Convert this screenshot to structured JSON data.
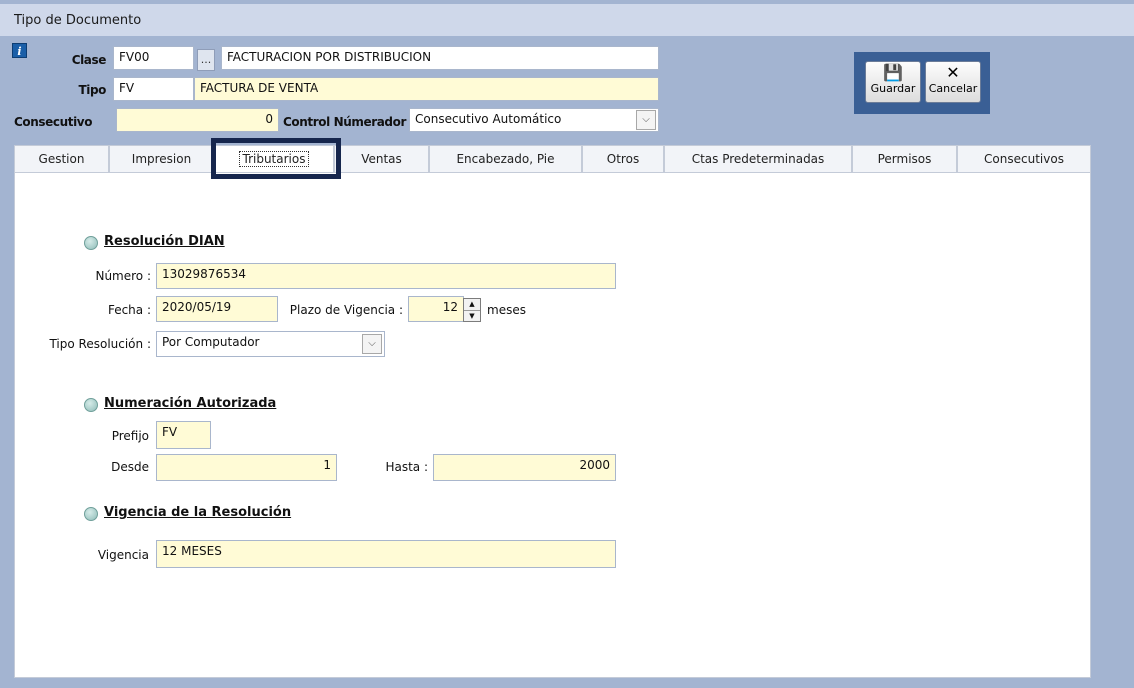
{
  "window": {
    "title": "Tipo de Documento"
  },
  "header": {
    "clase_label": "Clase",
    "clase_code": "FV00",
    "clase_dots": "...",
    "clase_desc": "FACTURACION POR DISTRIBUCION",
    "tipo_label": "Tipo",
    "tipo_code": "FV",
    "tipo_desc": "FACTURA DE VENTA",
    "consecutivo_label": "Consecutivo",
    "consecutivo_value": "0",
    "control_label": "Control Númerador :",
    "control_value": "Consecutivo Automático"
  },
  "toolbar": {
    "guardar_label": "Guardar",
    "cancelar_label": "Cancelar"
  },
  "tabs": [
    {
      "label": "Gestion"
    },
    {
      "label": "Impresion"
    },
    {
      "label": "Tributarios",
      "active": true
    },
    {
      "label": "Ventas"
    },
    {
      "label": "Encabezado, Pie"
    },
    {
      "label": "Otros"
    },
    {
      "label": "Ctas Predeterminadas"
    },
    {
      "label": "Permisos"
    },
    {
      "label": "Consecutivos"
    }
  ],
  "resolucion": {
    "title": "Resolución DIAN",
    "numero_label": "Número :",
    "numero_value": "13029876534",
    "fecha_label": "Fecha :",
    "fecha_value": "2020/05/19",
    "plazo_label": "Plazo de Vigencia :",
    "plazo_value": "12",
    "plazo_unit": "meses",
    "tipo_label": "Tipo Resolución :",
    "tipo_value": "Por Computador"
  },
  "numeracion": {
    "title": "Numeración  Autorizada",
    "prefijo_label": "Prefijo",
    "prefijo_value": "FV",
    "desde_label": "Desde",
    "desde_value": "1",
    "hasta_label": "Hasta :",
    "hasta_value": "2000"
  },
  "vigencia": {
    "title": "Vigencia de la Resolución",
    "vigencia_label": "Vigencia",
    "vigencia_value": "12 MESES"
  },
  "icons": {
    "info": "info-icon",
    "save": "floppy-disk-icon",
    "cancel": "cross-icon",
    "dropdown": "chevron-down-icon",
    "spin": "spin-arrows-icon",
    "bullet": "circle-bullet-icon"
  },
  "colors": {
    "background": "#a3b4d1",
    "field_fill": "#fffbd6",
    "panel": "#3a5f95",
    "tab_highlight": "#16264d"
  }
}
